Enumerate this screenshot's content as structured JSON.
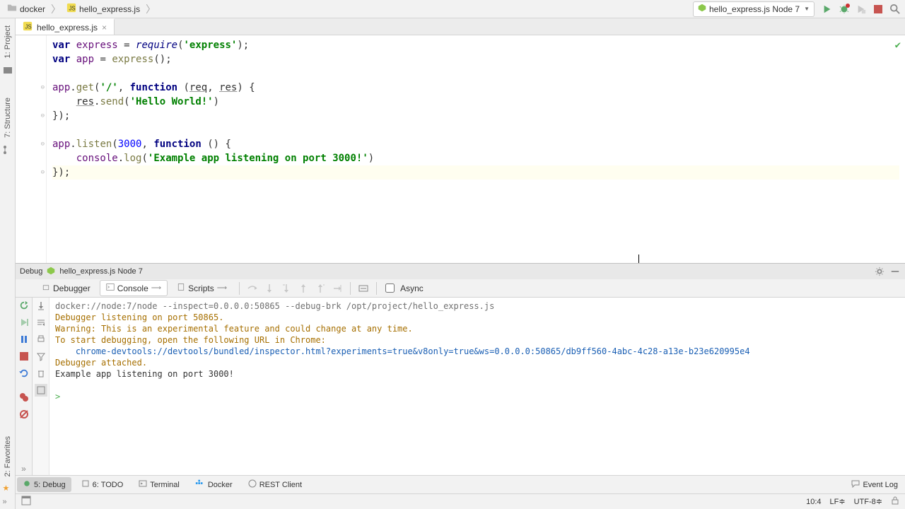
{
  "breadcrumb": {
    "folder": "docker",
    "file": "hello_express.js"
  },
  "run_config": "hello_express.js Node 7",
  "editor": {
    "tab_name": "hello_express.js"
  },
  "debug": {
    "header_prefix": "Debug",
    "header_config": "hello_express.js Node 7",
    "tab_debugger": "Debugger",
    "tab_console": "Console",
    "tab_scripts": "Scripts",
    "async_label": "Async"
  },
  "console": {
    "line1": "docker://node:7/node --inspect=0.0.0.0:50865 --debug-brk /opt/project/hello_express.js",
    "line2": "Debugger listening on port 50865.",
    "line3": "Warning: This is an experimental feature and could change at any time.",
    "line4": "To start debugging, open the following URL in Chrome:",
    "line5": "    chrome-devtools://devtools/bundled/inspector.html?experiments=true&v8only=true&ws=0.0.0.0:50865/db9ff560-4abc-4c28-a13e-b23e620995e4",
    "line6": "Debugger attached.",
    "line7": "Example app listening on port 3000!",
    "prompt": ">"
  },
  "bottom": {
    "debug": "5: Debug",
    "todo": "6: TODO",
    "terminal": "Terminal",
    "docker": "Docker",
    "rest": "REST Client",
    "eventlog": "Event Log"
  },
  "sidebar": {
    "project": "1: Project",
    "structure": "7: Structure",
    "favorites": "2: Favorites"
  },
  "status": {
    "pos": "10:4",
    "lineend": "LF≑",
    "encoding": "UTF-8≑"
  }
}
